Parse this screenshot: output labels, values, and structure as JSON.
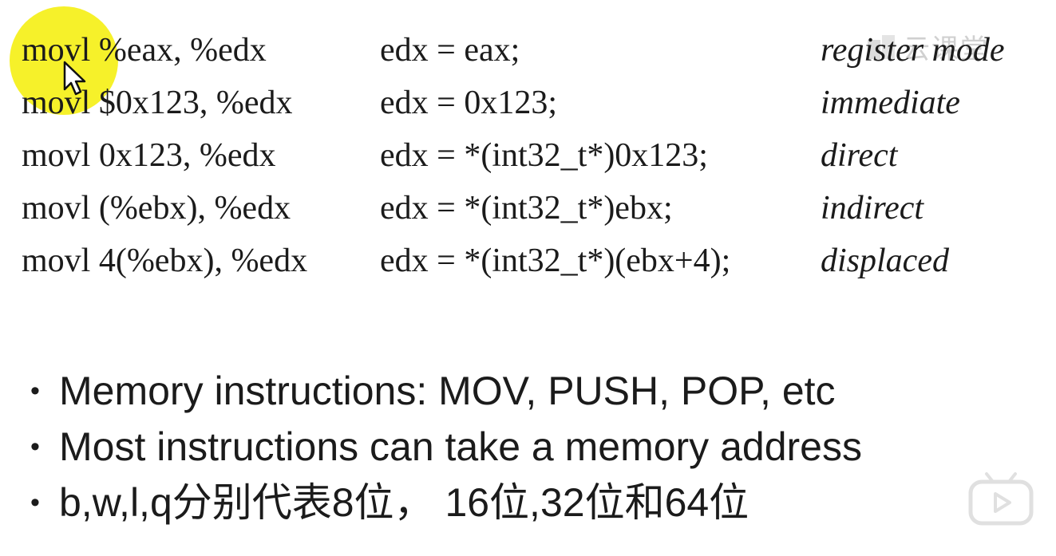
{
  "rows": [
    {
      "asm": "movl %eax, %edx",
      "c": "edx = eax;",
      "mode": "register mode"
    },
    {
      "asm": "movl $0x123, %edx",
      "c": "edx = 0x123;",
      "mode": "immediate"
    },
    {
      "asm": "movl 0x123, %edx",
      "c": "edx = *(int32_t*)0x123;",
      "mode": "direct"
    },
    {
      "asm": "movl (%ebx), %edx",
      "c": "edx = *(int32_t*)ebx;",
      "mode": "indirect"
    },
    {
      "asm": "movl 4(%ebx), %edx",
      "c": "edx = *(int32_t*)(ebx+4);",
      "mode": "displaced"
    }
  ],
  "bullets": [
    {
      "dot": "•",
      "text": "Memory instructions: MOV, PUSH, POP, etc"
    },
    {
      "dot": "•",
      "text": "Most instructions can take a memory address"
    },
    {
      "dot": "•",
      "text": "b,w,l,q分别代表8位， 16位,32位和64位"
    }
  ],
  "watermark": {
    "text": "云课堂",
    "icon": "watermark-logo-icon"
  },
  "colors": {
    "highlight": "#f6f01f",
    "text": "#1b1b1b"
  }
}
